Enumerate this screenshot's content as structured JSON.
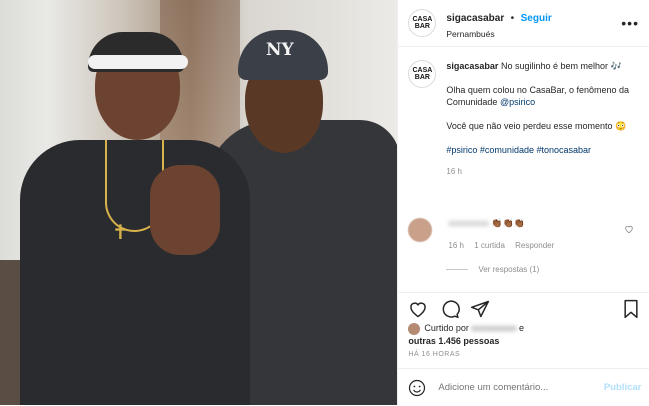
{
  "header": {
    "avatar_text_line1": "CASA",
    "avatar_text_line2": "BAR",
    "username": "sigacasabar",
    "separator": "•",
    "follow_label": "Seguir",
    "location": "Pernambués",
    "more_label": "•••"
  },
  "caption": {
    "username": "sigacasabar",
    "line1": "No sugilinho é bem melhor 🎶",
    "line2_prefix": "Olha quem colou no CasaBar, o fenômeno da Comunidade ",
    "mention": "@psirico",
    "line3": "Você que não veio perdeu esse momento 😳",
    "hashtags": [
      "#psirico",
      "#comunidade",
      "#tonocasabar"
    ],
    "time": "16 h"
  },
  "comment": {
    "username": "xxxxxxxxx",
    "text": "👏🏾👏🏾👏🏾",
    "time": "16 h",
    "likes": "1 curtida",
    "reply_label": "Responder",
    "view_replies": "Ver respostas (1)"
  },
  "likes": {
    "prefix": "Curtido por ",
    "user": "xxxxxxxxx",
    "suffix": " e",
    "others": "outras 1.456 pessoas"
  },
  "post_time": "HÁ 16 HORAS",
  "add_comment": {
    "placeholder": "Adicione um comentário...",
    "publish_label": "Publicar"
  },
  "photo": {
    "cap_logo": "NY"
  }
}
